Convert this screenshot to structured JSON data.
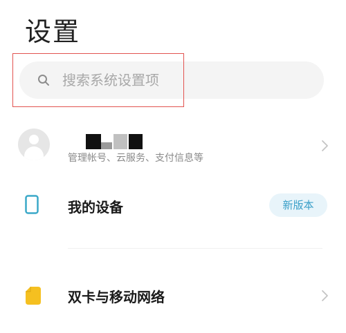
{
  "page": {
    "title": "设置"
  },
  "search": {
    "placeholder": "搜索系统设置项",
    "value": "",
    "icon": "search-icon"
  },
  "account": {
    "subtitle": "管理帐号、云服务、支付信息等",
    "icon": "avatar-placeholder-icon"
  },
  "items": [
    {
      "label": "我的设备",
      "icon": "phone-device-icon",
      "badge": "新版本",
      "icon_color": "#3aa8c8",
      "badge_color": "#3a9fc8"
    },
    {
      "label": "双卡与移动网络",
      "icon": "sim-card-icon",
      "icon_color": "#f5c020"
    }
  ],
  "colors": {
    "highlight": "#e2524f",
    "chevron": "#c4c4c4",
    "search_background": "#f4f4f4"
  }
}
